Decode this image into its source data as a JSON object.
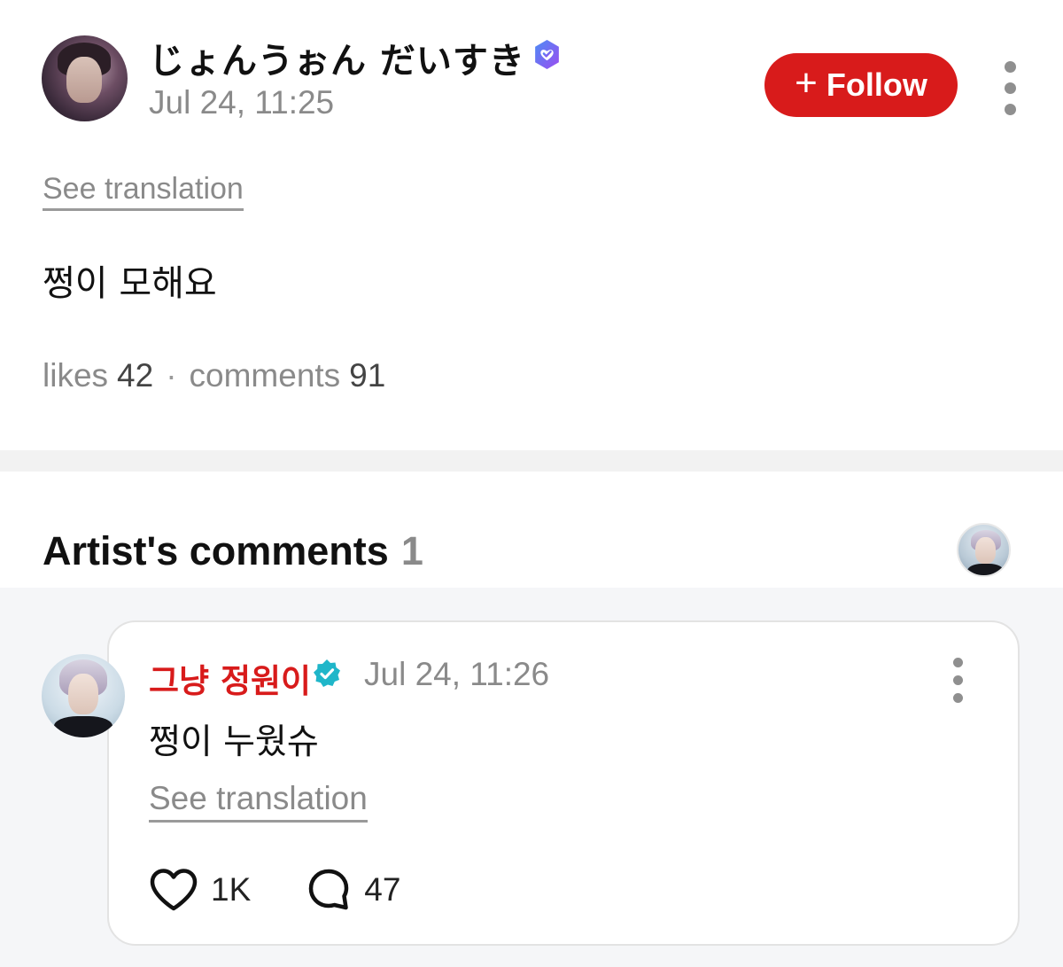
{
  "post": {
    "author_name": "じょんうぉん だいすき",
    "timestamp": "Jul 24, 11:25",
    "follow_label": "Follow",
    "see_translation": "See translation",
    "body": "쩡이 모해요",
    "stats": {
      "likes_label": "likes",
      "likes_count": "42",
      "separator": "·",
      "comments_label": "comments",
      "comments_count": "91"
    }
  },
  "artist_comments": {
    "title": "Artist's comments",
    "count": "1",
    "items": [
      {
        "author": "그냥 정원이",
        "timestamp": "Jul 24, 11:26",
        "body": "쩡이 누웠슈",
        "see_translation": "See translation",
        "likes": "1K",
        "replies": "47"
      }
    ]
  },
  "colors": {
    "accent": "#d81b1b",
    "muted_text": "#8a8a8a",
    "fan_badge": "#7b5cf0",
    "artist_badge": "#1fb6c9"
  },
  "icons": {
    "author_badge": "fan-verified-badge-icon",
    "artist_badge": "artist-verified-badge-icon",
    "more": "more-vertical-icon",
    "like": "heart-icon",
    "reply": "speech-bubble-icon",
    "follow": "plus-icon"
  }
}
